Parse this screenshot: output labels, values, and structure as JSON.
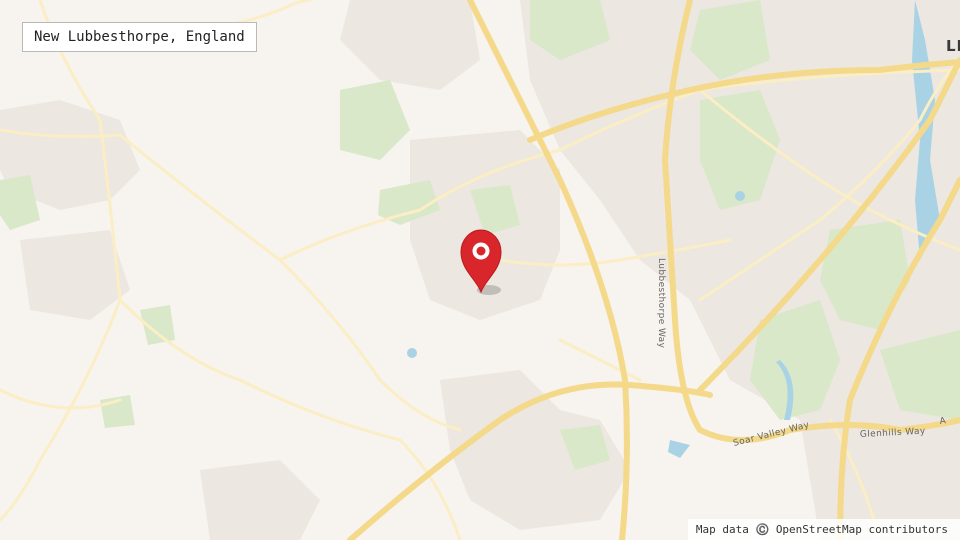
{
  "location_label": "New Lubbesthorpe, England",
  "attribution": "Map data ©️ OpenStreetMap contributors",
  "roads": {
    "lubbesthorpe_way": "Lubbesthorpe Way",
    "soar_valley_way": "Soar Valley Way",
    "glenhills_way": "Glenhills Way",
    "road_a": "A"
  },
  "places": {
    "leicester_partial": "LE"
  },
  "marker": {
    "icon": "map-pin-icon",
    "color": "#d9262b"
  },
  "colors": {
    "background": "#f7f3ee",
    "urban": "#ece7e0",
    "green": "#d8e8c9",
    "major_road": "#f4d98a",
    "minor_road": "#fbeec4",
    "water": "#a9d3e5"
  }
}
